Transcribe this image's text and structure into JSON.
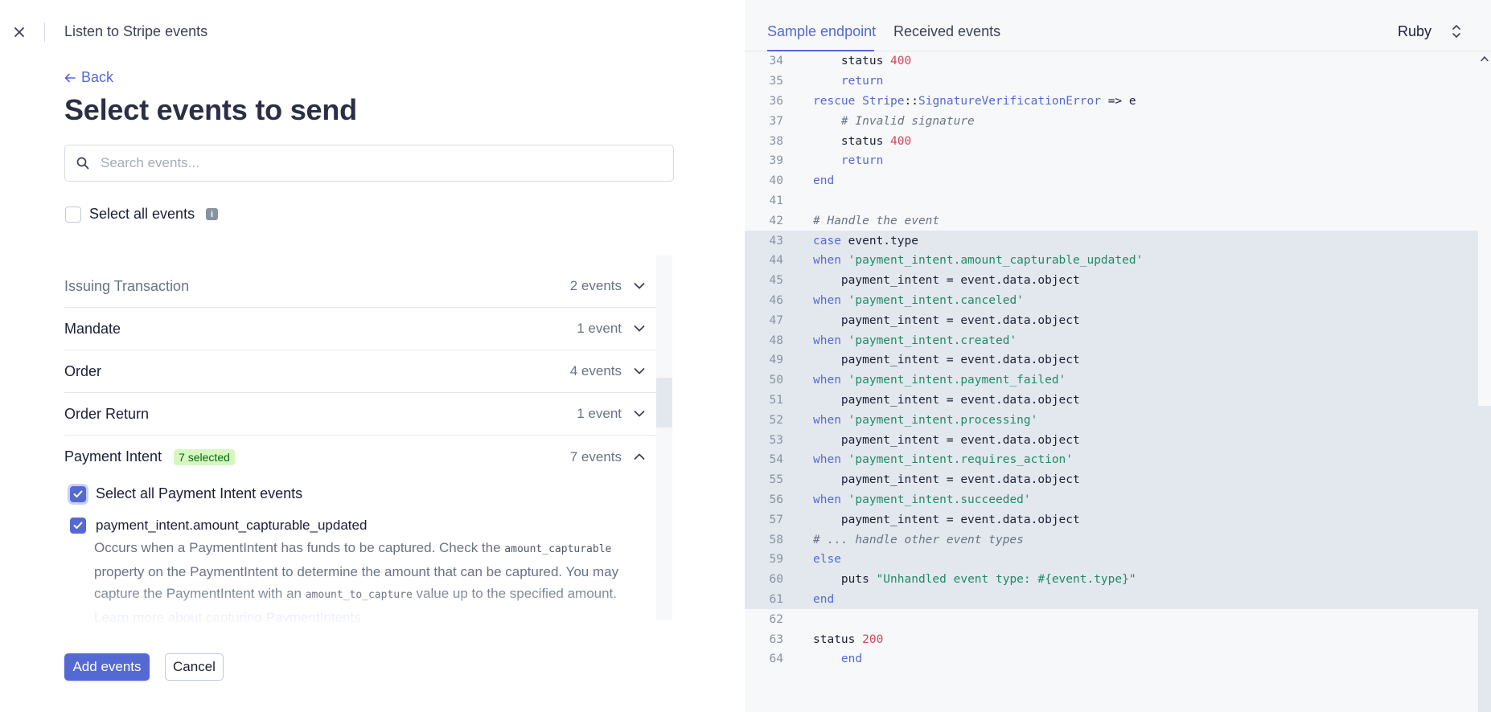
{
  "header": {
    "title": "Listen to Stripe events"
  },
  "nav": {
    "back_label": "Back"
  },
  "page": {
    "title": "Select events to send"
  },
  "search": {
    "placeholder": "Search events...",
    "value": ""
  },
  "select_all": {
    "label": "Select all events",
    "checked": false
  },
  "event_groups": [
    {
      "name": "Issuing Transaction",
      "count": "2 events",
      "expanded": false
    },
    {
      "name": "Mandate",
      "count": "1 event",
      "expanded": false
    },
    {
      "name": "Order",
      "count": "4 events",
      "expanded": false
    },
    {
      "name": "Order Return",
      "count": "1 event",
      "expanded": false
    },
    {
      "name": "Payment Intent",
      "count": "7 events",
      "badge": "7 selected",
      "expanded": true
    }
  ],
  "payment_intent": {
    "select_all_label": "Select all Payment Intent events",
    "event_name": "payment_intent.amount_capturable_updated",
    "desc_part1": "Occurs when a PaymentIntent has funds to be captured. Check the ",
    "desc_code1": "amount_capturable",
    "desc_part2": " property on the PaymentIntent to determine the amount that can be captured. You may capture the PaymentIntent with an ",
    "desc_code2": "amount_to_capture",
    "desc_part3": " value up to the specified amount.",
    "learn_more": "Learn more about capturing PaymentIntents."
  },
  "actions": {
    "add_label": "Add events",
    "cancel_label": "Cancel"
  },
  "right_tabs": {
    "sample": "Sample endpoint",
    "received": "Received events",
    "language": "Ruby"
  },
  "code_lines": [
    {
      "n": "34",
      "t": "            status 400"
    },
    {
      "n": "35",
      "t": "            return"
    },
    {
      "n": "36",
      "t": "        rescue Stripe::SignatureVerificationError => e"
    },
    {
      "n": "37",
      "t": "            # Invalid signature"
    },
    {
      "n": "38",
      "t": "            status 400"
    },
    {
      "n": "39",
      "t": "            return"
    },
    {
      "n": "40",
      "t": "        end"
    },
    {
      "n": "41",
      "t": ""
    },
    {
      "n": "42",
      "t": "        # Handle the event"
    },
    {
      "n": "43",
      "t": "        case event.type"
    },
    {
      "n": "44",
      "t": "        when 'payment_intent.amount_capturable_updated'"
    },
    {
      "n": "45",
      "t": "            payment_intent = event.data.object"
    },
    {
      "n": "46",
      "t": "        when 'payment_intent.canceled'"
    },
    {
      "n": "47",
      "t": "            payment_intent = event.data.object"
    },
    {
      "n": "48",
      "t": "        when 'payment_intent.created'"
    },
    {
      "n": "49",
      "t": "            payment_intent = event.data.object"
    },
    {
      "n": "50",
      "t": "        when 'payment_intent.payment_failed'"
    },
    {
      "n": "51",
      "t": "            payment_intent = event.data.object"
    },
    {
      "n": "52",
      "t": "        when 'payment_intent.processing'"
    },
    {
      "n": "53",
      "t": "            payment_intent = event.data.object"
    },
    {
      "n": "54",
      "t": "        when 'payment_intent.requires_action'"
    },
    {
      "n": "55",
      "t": "            payment_intent = event.data.object"
    },
    {
      "n": "56",
      "t": "        when 'payment_intent.succeeded'"
    },
    {
      "n": "57",
      "t": "            payment_intent = event.data.object"
    },
    {
      "n": "58",
      "t": "        # ... handle other event types"
    },
    {
      "n": "59",
      "t": "        else"
    },
    {
      "n": "60",
      "t": "            puts \"Unhandled event type: #{event.type}\""
    },
    {
      "n": "61",
      "t": "        end"
    },
    {
      "n": "62",
      "t": ""
    },
    {
      "n": "63",
      "t": "        status 200"
    },
    {
      "n": "64",
      "t": "    end"
    }
  ],
  "highlight_range": [
    "43",
    "61"
  ],
  "colors": {
    "accent": "#5469d4",
    "badge_bg": "#d7f7c2",
    "badge_text": "#05690d",
    "code_string": "#1f8a65",
    "code_number": "#d6455d"
  }
}
